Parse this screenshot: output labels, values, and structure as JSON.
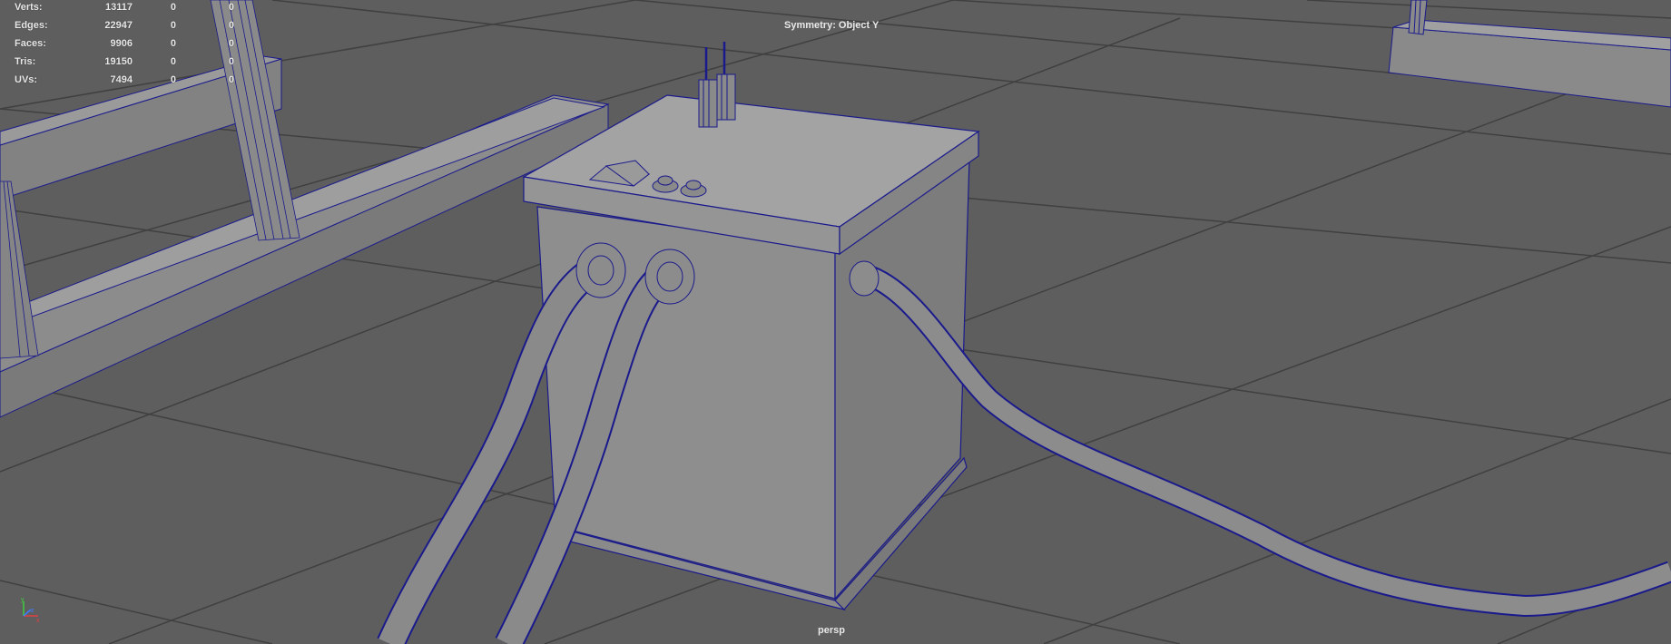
{
  "viewport": {
    "camera": "persp",
    "symmetry_label": "Symmetry: Object Y",
    "grid": true
  },
  "hud_stats": {
    "rows": [
      {
        "label": "Verts:",
        "total": "13117",
        "selected": "0",
        "component": "0"
      },
      {
        "label": "Edges:",
        "total": "22947",
        "selected": "0",
        "component": "0"
      },
      {
        "label": "Faces:",
        "total": "9906",
        "selected": "0",
        "component": "0"
      },
      {
        "label": "Tris:",
        "total": "19150",
        "selected": "0",
        "component": "0"
      },
      {
        "label": "UVs:",
        "total": "7494",
        "selected": "0",
        "component": "0"
      }
    ]
  },
  "axis_indicator": {
    "y": "y",
    "x": "x",
    "z": "z"
  },
  "colors": {
    "background": "#5e5e5e",
    "grid_line": "#3c3c3c",
    "wire": "#1a1a8c",
    "mesh_light": "#9a9a9a",
    "mesh_mid": "#8a8a8a",
    "mesh_dark": "#7a7a7a",
    "hud_text": "#e8e8e8"
  }
}
